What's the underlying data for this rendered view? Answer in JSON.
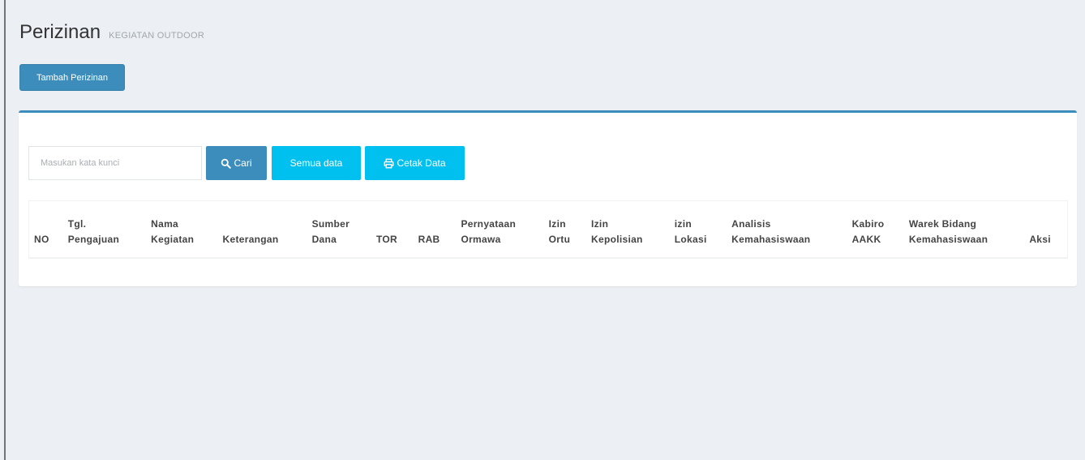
{
  "header": {
    "title": "Perizinan",
    "subtitle": "KEGIATAN OUTDOOR"
  },
  "actions": {
    "add_label": "Tambah Perizinan"
  },
  "search": {
    "placeholder": "Masukan kata kunci",
    "search_label": "Cari",
    "all_data_label": "Semua data",
    "print_label": "Cetak Data"
  },
  "table": {
    "columns": [
      {
        "line1": "",
        "line2": "NO"
      },
      {
        "line1": "Tgl.",
        "line2": "Pengajuan"
      },
      {
        "line1": "Nama",
        "line2": "Kegiatan"
      },
      {
        "line1": "",
        "line2": "Keterangan"
      },
      {
        "line1": "Sumber",
        "line2": "Dana"
      },
      {
        "line1": "",
        "line2": "TOR"
      },
      {
        "line1": "",
        "line2": "RAB"
      },
      {
        "line1": "Pernyataan",
        "line2": "Ormawa"
      },
      {
        "line1": "Izin",
        "line2": "Ortu"
      },
      {
        "line1": "Izin",
        "line2": "Kepolisian"
      },
      {
        "line1": "izin",
        "line2": "Lokasi"
      },
      {
        "line1": "Analisis",
        "line2": "Kemahasiswaan"
      },
      {
        "line1": "Kabiro",
        "line2": "AAKK"
      },
      {
        "line1": "Warek Bidang",
        "line2": "Kemahasiswaan"
      },
      {
        "line1": "",
        "line2": "Aksi"
      }
    ],
    "rows": []
  },
  "icons": {
    "search": "search-icon",
    "print": "print-icon"
  },
  "colors": {
    "primary": "#3c8dbc",
    "info": "#00c0ef",
    "background": "#ecf0f5"
  }
}
